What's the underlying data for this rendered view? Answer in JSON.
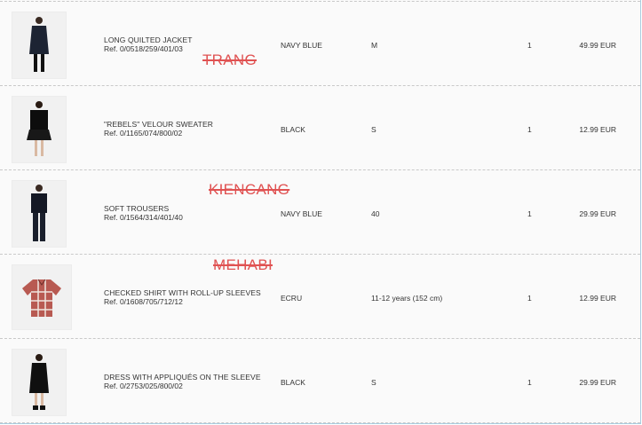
{
  "items": [
    {
      "name": "LONG QUILTED JACKET",
      "ref": "Ref. 0/0518/259/401/03",
      "color": "NAVY BLUE",
      "size": "M",
      "qty": "1",
      "price": "49.99 EUR",
      "stamp": "TRANG"
    },
    {
      "name": "\"REBELS\" VELOUR SWEATER",
      "ref": "Ref. 0/1165/074/800/02",
      "color": "BLACK",
      "size": "S",
      "qty": "1",
      "price": "12.99 EUR",
      "stamp": ""
    },
    {
      "name": "SOFT TROUSERS",
      "ref": "Ref. 0/1564/314/401/40",
      "color": "NAVY BLUE",
      "size": "40",
      "qty": "1",
      "price": "29.99 EUR",
      "stamp": "KIENCANG"
    },
    {
      "name": "CHECKED SHIRT WITH ROLL-UP SLEEVES",
      "ref": "Ref. 0/1608/705/712/12",
      "color": "ECRU",
      "size": "11-12 years (152 cm)",
      "qty": "1",
      "price": "12.99 EUR",
      "stamp": "MEHABI"
    },
    {
      "name": "DRESS WITH APPLIQUÉS ON THE SLEEVE",
      "ref": "Ref. 0/2753/025/800/02",
      "color": "BLACK",
      "size": "S",
      "qty": "1",
      "price": "29.99 EUR",
      "stamp": ""
    }
  ],
  "colors": {
    "stamp": "#e05252",
    "divider": "#c9c9c9",
    "frame": "#a9cde0"
  }
}
